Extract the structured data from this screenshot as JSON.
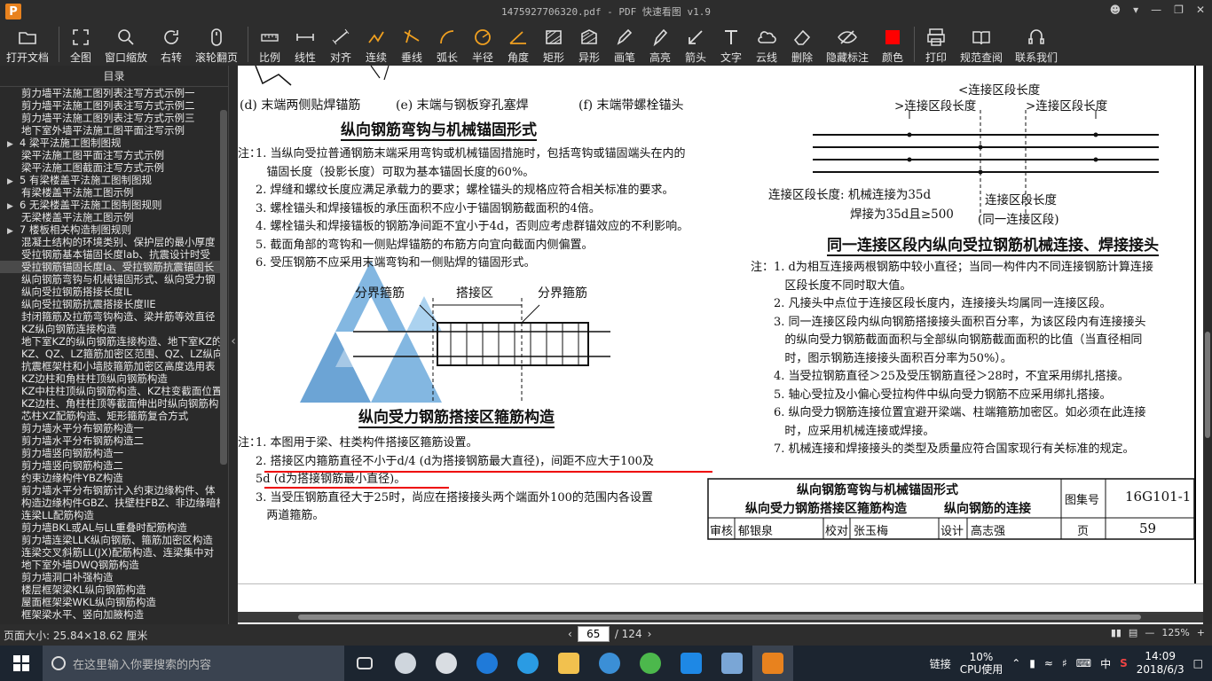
{
  "window": {
    "title": "1475927706320.pdf - PDF 快速看图 v1.9",
    "logo": "P"
  },
  "toolbar": [
    {
      "label": "打开文档",
      "icon": "folder-icon"
    },
    {
      "sep": true
    },
    {
      "label": "全图",
      "icon": "fullview-icon"
    },
    {
      "label": "窗口缩放",
      "icon": "zoom-icon"
    },
    {
      "label": "右转",
      "icon": "rotate-icon"
    },
    {
      "label": "滚轮翻页",
      "icon": "mouse-icon"
    },
    {
      "sep": true
    },
    {
      "label": "比例",
      "icon": "scale-icon"
    },
    {
      "label": "线性",
      "icon": "linear-icon"
    },
    {
      "label": "对齐",
      "icon": "align-icon"
    },
    {
      "label": "连续",
      "icon": "continuous-icon"
    },
    {
      "label": "垂线",
      "icon": "perpendicular-icon"
    },
    {
      "label": "弧长",
      "icon": "arc-icon"
    },
    {
      "label": "半径",
      "icon": "radius-icon"
    },
    {
      "label": "角度",
      "icon": "angle-icon"
    },
    {
      "label": "矩形",
      "icon": "rect-icon"
    },
    {
      "label": "异形",
      "icon": "polygon-icon"
    },
    {
      "label": "画笔",
      "icon": "pen-icon"
    },
    {
      "label": "高亮",
      "icon": "highlight-icon"
    },
    {
      "label": "箭头",
      "icon": "arrow-icon"
    },
    {
      "label": "文字",
      "icon": "text-icon"
    },
    {
      "label": "云线",
      "icon": "cloud-icon"
    },
    {
      "label": "删除",
      "icon": "eraser-icon"
    },
    {
      "label": "隐藏标注",
      "icon": "hide-icon"
    },
    {
      "label": "颜色",
      "icon": "color-icon",
      "color": "#ff0000"
    },
    {
      "sep": true
    },
    {
      "label": "打印",
      "icon": "print-icon"
    },
    {
      "label": "规范查阅",
      "icon": "book-icon"
    },
    {
      "label": "联系我们",
      "icon": "contact-icon"
    }
  ],
  "sidebar": {
    "title": "目录",
    "items": [
      {
        "label": "剪力墙平法施工图列表注写方式示例一"
      },
      {
        "label": "剪力墙平法施工图列表注写方式示例二"
      },
      {
        "label": "剪力墙平法施工图列表注写方式示例三"
      },
      {
        "label": "地下室外墙平法施工图平面注写示例"
      },
      {
        "label": "4 梁平法施工图制图规",
        "sec": true
      },
      {
        "label": "梁平法施工图平面注写方式示例"
      },
      {
        "label": "梁平法施工图截面注写方式示例"
      },
      {
        "label": "5 有梁楼盖平法施工图制图规",
        "sec": true
      },
      {
        "label": "有梁楼盖平法施工图示例"
      },
      {
        "label": "6 无梁楼盖平法施工图制图规则",
        "sec": true
      },
      {
        "label": "无梁楼盖平法施工图示例"
      },
      {
        "label": "7 楼板相关构造制图规则",
        "sec": true
      },
      {
        "label": "混凝土结构的环境类别、保护层的最小厚度"
      },
      {
        "label": "受拉钢筋基本锚固长度lab、抗震设计时受"
      },
      {
        "label": "受拉钢筋锚固长度la、受拉钢筋抗震锚固长",
        "hl": true
      },
      {
        "label": "纵向钢筋弯钩与机械锚固形式、纵向受力钢"
      },
      {
        "label": "纵向受拉钢筋搭接长度lL"
      },
      {
        "label": "纵向受拉钢筋抗震搭接长度llE"
      },
      {
        "label": "封闭箍筋及拉筋弯钩构造、梁并筋等效直径"
      },
      {
        "label": "KZ纵向钢筋连接构造"
      },
      {
        "label": "地下室KZ的纵向钢筋连接构造、地下室KZ的"
      },
      {
        "label": "KZ、QZ、LZ箍筋加密区范围、QZ、LZ纵向钢"
      },
      {
        "label": "抗震框架柱和小墙肢箍筋加密区高度选用表"
      },
      {
        "label": "KZ边柱和角柱柱顶纵向钢筋构造"
      },
      {
        "label": "KZ中柱柱顶纵向钢筋构造、KZ柱变截面位置"
      },
      {
        "label": "KZ边柱、角柱柱顶等截面伸出时纵向钢筋构"
      },
      {
        "label": "芯柱XZ配筋构造、矩形箍筋复合方式"
      },
      {
        "label": "剪力墙水平分布钢筋构造一"
      },
      {
        "label": "剪力墙水平分布钢筋构造二"
      },
      {
        "label": "剪力墙竖向钢筋构造一"
      },
      {
        "label": "剪力墙竖向钢筋构造二"
      },
      {
        "label": "约束边缘构件YBZ构造"
      },
      {
        "label": "剪力墙水平分布钢筋计入约束边缘构件、体"
      },
      {
        "label": "构造边缘构件GBZ、扶壁柱FBZ、非边缘暗柱"
      },
      {
        "label": "连梁LL配筋构造"
      },
      {
        "label": "剪力墙BKL或AL与LL重叠时配筋构造"
      },
      {
        "label": "剪力墙连梁LLK纵向钢筋、箍筋加密区构造"
      },
      {
        "label": "连梁交叉斜筋LL(JX)配筋构造、连梁集中对"
      },
      {
        "label": "地下室外墙DWQ钢筋构造"
      },
      {
        "label": "剪力墙洞口补强构造"
      },
      {
        "label": "楼层框架梁KL纵向钢筋构造"
      },
      {
        "label": "屋面框架梁WKL纵向钢筋构造"
      },
      {
        "label": "框架梁水平、竖向加腋构造"
      }
    ]
  },
  "page": {
    "captions": [
      "(d) 末端两侧贴焊锚筋",
      "(e) 末端与钢板穿孔塞焊",
      "(f) 末端带螺栓锚头"
    ],
    "section1_title": "纵向钢筋弯钩与机械锚固形式",
    "note_label": "注：",
    "notes1": [
      "1. 当纵向受拉普通钢筋末端采用弯钩或机械锚固措施时，包括弯钩或锚固端头在内的",
      "   锚固长度（投影长度）可取为基本锚固长度的60%。",
      "2. 焊缝和螺纹长度应满足承载力的要求；螺栓锚头的规格应符合相关标准的要求。",
      "3. 螺栓锚头和焊接锚板的承压面积不应小于锚固钢筋截面积的4倍。",
      "4. 螺栓锚头和焊接锚板的钢筋净间距不宜小于4d，否则应考虑群锚效应的不利影响。",
      "5. 截面角部的弯钩和一侧贴焊锚筋的布筋方向宜向截面内侧偏置。",
      "6. 受压钢筋不应采用末端弯钩和一侧贴焊的锚固形式。"
    ],
    "diagram_labels": {
      "left": "分界箍筋",
      "middle": "搭接区",
      "right": "分界箍筋"
    },
    "section2_title": "纵向受力钢筋搭接区箍筋构造",
    "notes2": [
      "1. 本图用于梁、柱类构件搭接区箍筋设置。",
      "2. 搭接区内箍筋直径不小于d/4 (d为搭接钢筋最大直径)，间距不应大于100及",
      "5d (d为搭接钢筋最小直径)。",
      "3. 当受压钢筋直径大于25时，尚应在搭接接头两个端面外100的范围内各设置",
      "   两道箍筋。"
    ],
    "right_top_labels": {
      "top": "<连接区段长度",
      "left": ">连接区段长度",
      "right": ">连接区段长度"
    },
    "right_mid": {
      "label_a": "连接区段长度: 机械连接为35d",
      "label_b": "焊接为35d且≥500",
      "label_c": "连接区段长度",
      "label_d": "(同一连接区段)"
    },
    "section3_title": "同一连接区段内纵向受拉钢筋机械连接、焊接接头",
    "notes3": [
      "1. d为相互连接两根钢筋中较小直径；当同一构件内不同连接钢筋计算连接",
      "   区段长度不同时取大值。",
      "2. 凡接头中点位于连接区段长度内，连接接头均属同一连接区段。",
      "3. 同一连接区段内纵向钢筋搭接接头面积百分率，为该区段内有连接接头",
      "   的纵向受力钢筋截面面积与全部纵向钢筋截面面积的比值（当直径相同",
      "   时，图示钢筋连接接头面积百分率为50%）。",
      "4. 当受拉钢筋直径＞25及受压钢筋直径＞28时，不宜采用绑扎搭接。",
      "5. 轴心受拉及小偏心受拉构件中纵向受力钢筋不应采用绑扎搭接。",
      "6. 纵向受力钢筋连接位置宜避开梁端、柱端箍筋加密区。如必须在此连接",
      "   时，应采用机械连接或焊接。",
      "7. 机械连接和焊接接头的类型及质量应符合国家现行有关标准的规定。"
    ],
    "titleblock": {
      "title_line1": "纵向钢筋弯钩与机械锚固形式",
      "title_line2": "纵向受力钢筋搭接区箍筋构造",
      "title_line3": "纵向钢筋的连接",
      "atlas_label": "图集号",
      "atlas_no": "16G101-1",
      "review": "审核",
      "reviewer": "郁银泉",
      "check": "校对",
      "checker": "张玉梅",
      "design": "设计",
      "designer": "高志强",
      "page_label": "页",
      "page_no": "59"
    }
  },
  "status": {
    "page_size": "页面大小: 25.84×18.62 厘米",
    "current_page": "65",
    "total_pages": "/ 124",
    "zoom": "125%"
  },
  "taskbar": {
    "search_placeholder": "在这里输入你要搜索的内容",
    "link_label": "链接",
    "cpu_value": "10%",
    "cpu_label": "CPU使用",
    "ime": "中",
    "time": "14:09",
    "date": "2018/6/3"
  }
}
